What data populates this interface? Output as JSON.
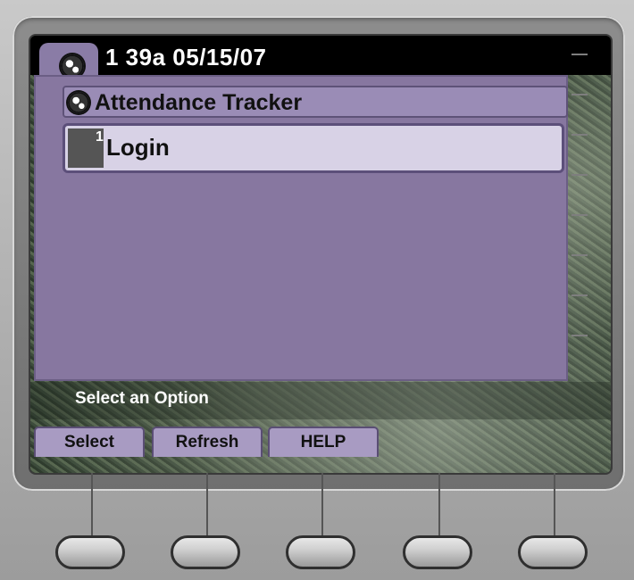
{
  "header": {
    "time_date": "1 39a 05/15/07"
  },
  "app": {
    "title": "Attendance Tracker"
  },
  "menu": {
    "items": [
      {
        "number": "1",
        "label": "Login"
      }
    ]
  },
  "status": {
    "prompt": "Select an Option"
  },
  "softkeys": [
    "Select",
    "Refresh",
    "HELP"
  ],
  "colors": {
    "content_bg": "#8777a0",
    "selected_item_bg": "#d8d2e6",
    "softkey_bg": "#a89bc2",
    "header_bg": "#000000"
  },
  "icons": {
    "header": "globe-icon",
    "title": "globe-icon"
  }
}
